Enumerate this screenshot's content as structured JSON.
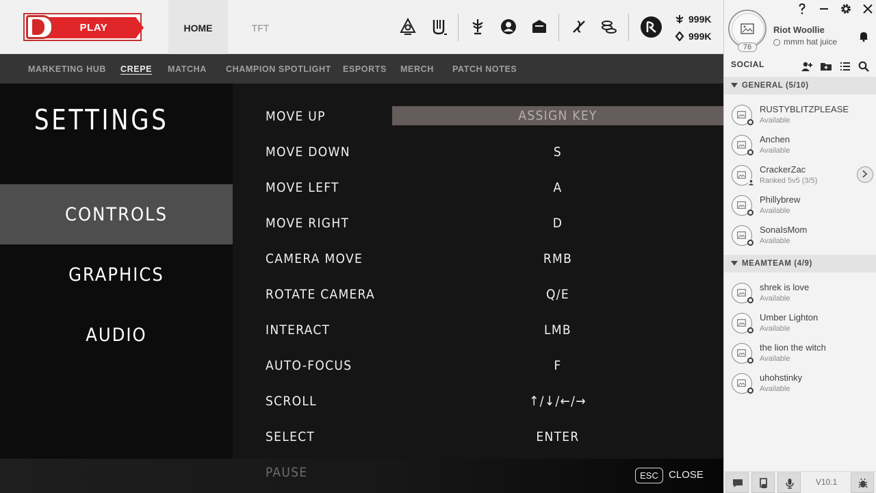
{
  "header": {
    "play_label": "PLAY",
    "tabs": [
      {
        "label": "HOME",
        "active": true
      },
      {
        "label": "TFT",
        "active": false
      }
    ],
    "currencies": [
      {
        "icon": "blue-essence-icon",
        "value": "999K"
      },
      {
        "icon": "riot-points-icon",
        "value": "999K"
      }
    ],
    "icons": [
      "clash-icon",
      "collection-icon",
      "loot-icon",
      "profile-icon",
      "store-icon",
      "missions-icon",
      "crafting-icon",
      "rp-coin-icon"
    ]
  },
  "subnav": {
    "items": [
      {
        "label": "MARKETING HUB",
        "active": false
      },
      {
        "label": "CREPE",
        "active": true
      },
      {
        "label": "MATCHA",
        "active": false
      },
      {
        "label": "CHAMPION SPOTLIGHT",
        "active": false
      },
      {
        "label": "ESPORTS",
        "active": false
      },
      {
        "label": "MERCH",
        "active": false
      },
      {
        "label": "PATCH NOTES",
        "active": false
      }
    ]
  },
  "settings": {
    "title": "SETTINGS",
    "categories": [
      {
        "label": "CONTROLS",
        "active": true
      },
      {
        "label": "GRAPHICS",
        "active": false
      },
      {
        "label": "AUDIO",
        "active": false
      }
    ],
    "bindings": [
      {
        "action": "MOVE UP",
        "key": "ASSIGN KEY",
        "assigning": true
      },
      {
        "action": "MOVE DOWN",
        "key": "S"
      },
      {
        "action": "MOVE LEFT",
        "key": "A"
      },
      {
        "action": "MOVE RIGHT",
        "key": "D"
      },
      {
        "action": "CAMERA MOVE",
        "key": "RMB"
      },
      {
        "action": "ROTATE CAMERA",
        "key": "Q/E"
      },
      {
        "action": "INTERACT",
        "key": "LMB"
      },
      {
        "action": "AUTO-FOCUS",
        "key": "F"
      },
      {
        "action": "SCROLL",
        "key": "↑/↓/←/→"
      },
      {
        "action": "SELECT",
        "key": "ENTER"
      },
      {
        "action": "PAUSE",
        "key": ""
      }
    ],
    "esc_label": "ESC",
    "close_label": "CLOSE"
  },
  "social": {
    "window_controls": [
      "help-icon",
      "minimize-icon",
      "settings-icon",
      "close-icon"
    ],
    "profile": {
      "name": "Riot Woollie",
      "status": "mmm hat juice",
      "level": "76"
    },
    "label": "SOCIAL",
    "groups": [
      {
        "name": "GENERAL (5/10)",
        "friends": [
          {
            "name": "RUSTYBLITZPLEASE",
            "status": "Available"
          },
          {
            "name": "Anchen",
            "status": "Available"
          },
          {
            "name": "CrackerZac",
            "status": "Ranked 5v5 (3/5)"
          },
          {
            "name": "Phillybrew",
            "status": "Available"
          },
          {
            "name": "SonaIsMom",
            "status": "Available"
          }
        ]
      },
      {
        "name": "MEAMTEAM (4/9)",
        "friends": [
          {
            "name": "shrek is love",
            "status": "Available"
          },
          {
            "name": "Umber Lighton",
            "status": "Available"
          },
          {
            "name": "the lion the witch",
            "status": "Available"
          },
          {
            "name": "uhohstinky",
            "status": "Available"
          }
        ]
      }
    ],
    "version": "V10.1"
  },
  "colors": {
    "play_red": "#e1262a",
    "assign_bg": "#655c5c",
    "active_category": "#4e4e4e",
    "settings_bg": "#151515",
    "sidebar_bg": "#f3f3f3"
  }
}
